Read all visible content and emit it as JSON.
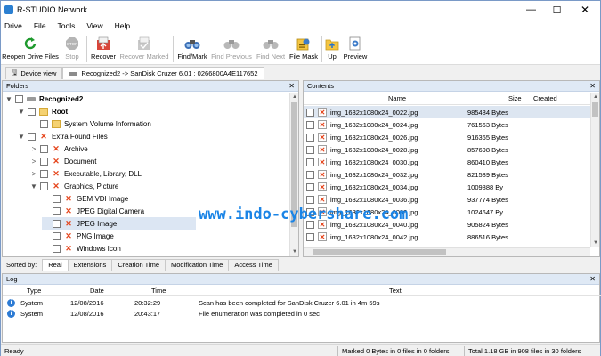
{
  "window": {
    "title": "R-STUDIO Network",
    "minimize": "—",
    "maximize": "☐",
    "close": "✕"
  },
  "menu": [
    "Drive",
    "File",
    "Tools",
    "View",
    "Help"
  ],
  "toolbar": {
    "reopen": "Reopen Drive Files",
    "stop": "Stop",
    "recover": "Recover",
    "recover_marked": "Recover Marked",
    "find_mark": "Find/Mark",
    "find_previous": "Find Previous",
    "find_next": "Find Next",
    "file_mask": "File Mask",
    "up": "Up",
    "preview": "Preview"
  },
  "tabs": {
    "device_view": "Device view",
    "recognized": "Recognized2 -> SanDisk Cruzer 6.01 : 0266800A4E117652"
  },
  "folders": {
    "header": "Folders",
    "items": [
      {
        "label": "Recognized2",
        "indent": 0,
        "expander": "▼",
        "icon": "drive",
        "bold": true
      },
      {
        "label": "Root",
        "indent": 1,
        "expander": "▼",
        "icon": "folder",
        "bold": true
      },
      {
        "label": "System Volume Information",
        "indent": 2,
        "expander": "",
        "icon": "folder"
      },
      {
        "label": "Extra Found Files",
        "indent": 1,
        "expander": "▼",
        "icon": "x"
      },
      {
        "label": "Archive",
        "indent": 2,
        "expander": ">",
        "icon": "x"
      },
      {
        "label": "Document",
        "indent": 2,
        "expander": ">",
        "icon": "x"
      },
      {
        "label": "Executable, Library, DLL",
        "indent": 2,
        "expander": ">",
        "icon": "x"
      },
      {
        "label": "Graphics, Picture",
        "indent": 2,
        "expander": "▼",
        "icon": "x"
      },
      {
        "label": "GEM VDI Image",
        "indent": 3,
        "expander": "",
        "icon": "x"
      },
      {
        "label": "JPEG Digital Camera",
        "indent": 3,
        "expander": "",
        "icon": "x"
      },
      {
        "label": "JPEG Image",
        "indent": 3,
        "expander": "",
        "icon": "x",
        "selected": true
      },
      {
        "label": "PNG Image",
        "indent": 3,
        "expander": "",
        "icon": "x"
      },
      {
        "label": "Windows Icon",
        "indent": 3,
        "expander": "",
        "icon": "x"
      }
    ]
  },
  "sortbar": {
    "label": "Sorted by:",
    "tabs": [
      "Real",
      "Extensions",
      "Creation Time",
      "Modification Time",
      "Access Time"
    ]
  },
  "contents": {
    "header": "Contents",
    "columns": {
      "name": "Name",
      "size": "Size",
      "created": "Created"
    },
    "files": [
      {
        "name": "img_1632x1080x24_0022.jpg",
        "size": "985484 Bytes",
        "selected": true
      },
      {
        "name": "img_1632x1080x24_0024.jpg",
        "size": "761563 Bytes"
      },
      {
        "name": "img_1632x1080x24_0026.jpg",
        "size": "916365 Bytes"
      },
      {
        "name": "img_1632x1080x24_0028.jpg",
        "size": "857698 Bytes"
      },
      {
        "name": "img_1632x1080x24_0030.jpg",
        "size": "860410 Bytes"
      },
      {
        "name": "img_1632x1080x24_0032.jpg",
        "size": "821589 Bytes"
      },
      {
        "name": "img_1632x1080x24_0034.jpg",
        "size": "1009888 By"
      },
      {
        "name": "img_1632x1080x24_0036.jpg",
        "size": "937774 Bytes"
      },
      {
        "name": "img_1632x1080x24_0038.jpg",
        "size": "1024647 By"
      },
      {
        "name": "img_1632x1080x24_0040.jpg",
        "size": "905824 Bytes"
      },
      {
        "name": "img_1632x1080x24_0042.jpg",
        "size": "886516 Bytes"
      }
    ]
  },
  "watermark": "www.indo-cybershare.com",
  "log": {
    "header": "Log",
    "columns": {
      "type": "Type",
      "date": "Date",
      "time": "Time",
      "text": "Text"
    },
    "rows": [
      {
        "type": "System",
        "date": "12/08/2016",
        "time": "20:32:29",
        "text": "Scan has been completed for SanDisk Cruzer 6.01 in 4m 59s"
      },
      {
        "type": "System",
        "date": "12/08/2016",
        "time": "20:43:17",
        "text": "File enumeration was completed in 0 sec"
      }
    ]
  },
  "status": {
    "ready": "Ready",
    "marked": "Marked 0 Bytes in 0 files in 0 folders",
    "total": "Total 1.18 GB in 908 files in 30 folders"
  },
  "colors": {
    "accent": "#1a84e6",
    "delete_marker": "#e5441b",
    "header_bg": "#dfe9f5"
  }
}
